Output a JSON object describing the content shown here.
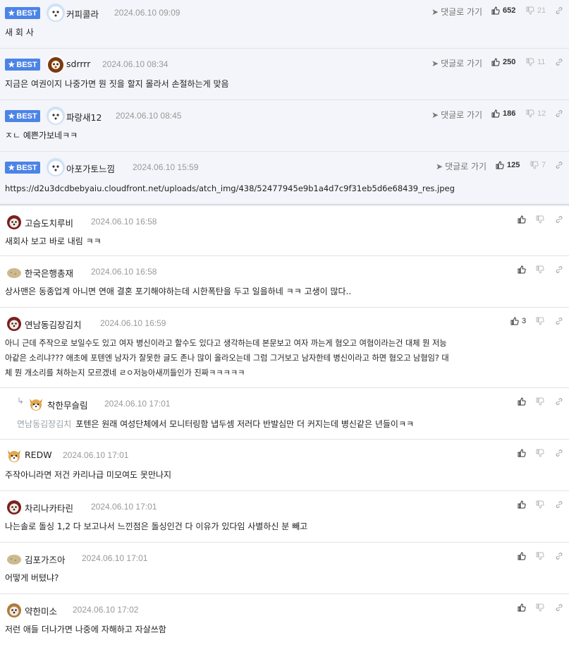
{
  "labels": {
    "best": "BEST",
    "reply_link": "댓글로 가기"
  },
  "best_comments": [
    {
      "nick": "커피콜라",
      "date": "2024.06.10 09:09",
      "up": "652",
      "down": "21",
      "text": "새 회 사",
      "avatar": "white-dog"
    },
    {
      "nick": "sdrrrr",
      "date": "2024.06.10 08:34",
      "up": "250",
      "down": "11",
      "text": "지금은 여권이지 나중가면 뭔 짓을 할지 몰라서 손절하는게 맞음",
      "avatar": "brown-bear"
    },
    {
      "nick": "파랑새12",
      "date": "2024.06.10 08:45",
      "up": "186",
      "down": "12",
      "text": "ㅈㄴ 예쁜가보네ㅋㅋ",
      "avatar": "white-dog"
    },
    {
      "nick": "아포가토느낌",
      "date": "2024.06.10 15:59",
      "up": "125",
      "down": "7",
      "text": "https://d2u3dcdbebyaiu.cloudfront.net/uploads/atch_img/438/52477945e9b1a4d7c9f31eb5d6e68439_res.jpeg",
      "avatar": "white-dog"
    }
  ],
  "comments": [
    {
      "nick": "고슴도치루비",
      "date": "2024.06.10 16:58",
      "up": "",
      "lines": [
        "새회사 보고 바로 내림 ㅋㅋ"
      ],
      "avatar": "puppy-red"
    },
    {
      "nick": "한국은행총재",
      "date": "2024.06.10 16:58",
      "up": "",
      "lines": [
        "상사맨은 동종업계 아니면 연애 결혼 포기해야하는데 시한폭탄을 두고 일을하네 ㅋㅋ 고생이 많다.."
      ],
      "avatar": "potato"
    },
    {
      "nick": "연남동김장김치",
      "date": "2024.06.10 16:59",
      "up": "3",
      "lines": [
        "아니 근데 주작으로 보일수도 있고 여자 병신이라고 할수도 있다고 생각하는데 본문보고 여자 까는게 혐오고 여혐이라는건 대체 뭔 저능",
        "아같은 소리냐??? 애초에 포텐엔 남자가 잘못한 글도 존나 많이 올라오는데 그럼 그거보고 남자한테 병신이라고 하면 혐오고 남혐임? 대",
        "체 뭔 개소리를 쳐하는지 모르겠네 ㄹㅇ저능아새끼들인가 진짜ㅋㅋㅋㅋㅋ"
      ],
      "avatar": "puppy-red"
    },
    {
      "nick": "착한무슬림",
      "date": "2024.06.10 17:01",
      "up": "",
      "reply": true,
      "mention": "연남동김장김치",
      "lines": [
        "포텐은 원래 여성단체에서 모니터링함 냅두셈 저러다 반발심만 더 커지는데 병신같은 년들이ㅋㅋ"
      ],
      "avatar": "corgi"
    },
    {
      "nick": "REDW",
      "date": "2024.06.10 17:01",
      "up": "",
      "lines": [
        "주작아니라면 저건 카리나급 미모여도 못만나지"
      ],
      "avatar": "corgi"
    },
    {
      "nick": "차리나카타린",
      "date": "2024.06.10 17:01",
      "up": "",
      "lines": [
        "나는솔로 돌싱 1,2 다 보고나서 느낀점은 돌싱인건 다 이유가 있다임 사별하신 분 빼고"
      ],
      "avatar": "puppy-red"
    },
    {
      "nick": "김포가즈아",
      "date": "2024.06.10 17:01",
      "up": "",
      "lines": [
        "어떻게 버텼냐?"
      ],
      "avatar": "potato"
    },
    {
      "nick": "약한미소",
      "date": "2024.06.10 17:02",
      "up": "",
      "lines": [
        "저런 애들 더나가면 나중에 자해하고 자살쓰함"
      ],
      "avatar": "puppy-brown"
    }
  ]
}
